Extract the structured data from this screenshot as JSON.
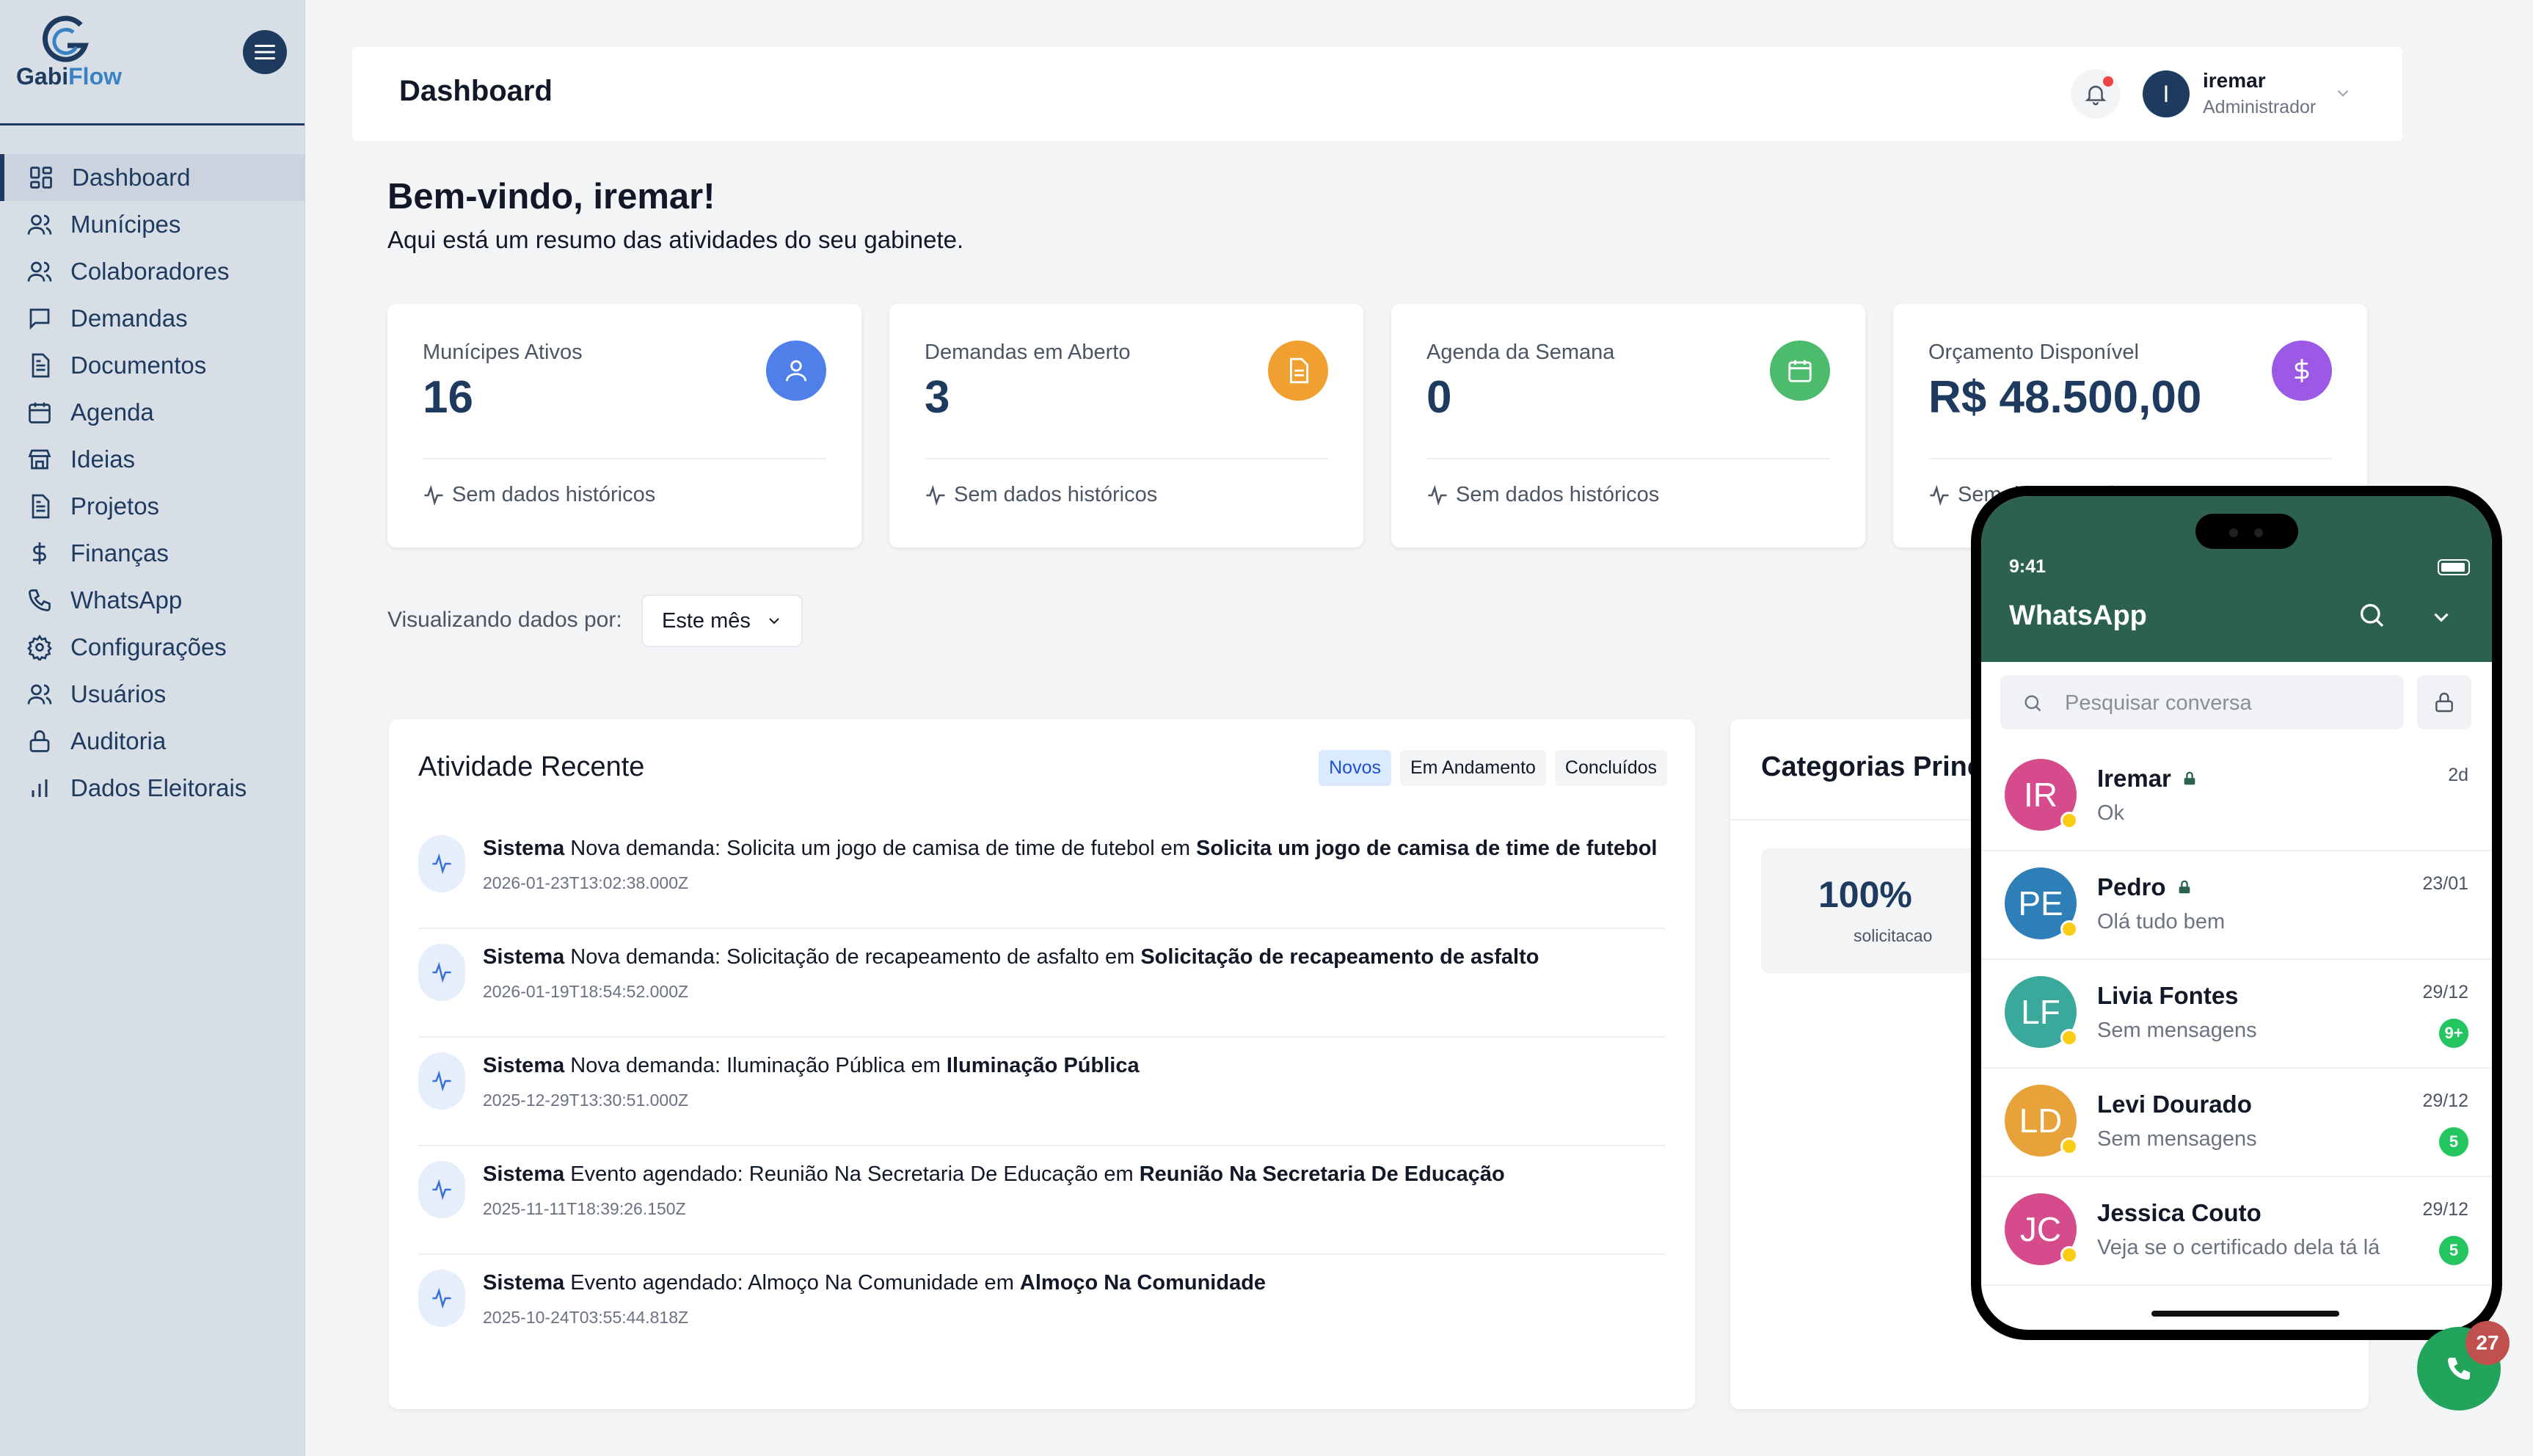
{
  "brand": {
    "name_part1": "Gabi",
    "name_part2": "Flow"
  },
  "sidebar": {
    "items": [
      {
        "label": "Dashboard",
        "icon": "grid-icon",
        "active": true
      },
      {
        "label": "Munícipes",
        "icon": "users-icon"
      },
      {
        "label": "Colaboradores",
        "icon": "users-icon"
      },
      {
        "label": "Demandas",
        "icon": "chat-square-icon"
      },
      {
        "label": "Documentos",
        "icon": "document-icon"
      },
      {
        "label": "Agenda",
        "icon": "calendar-icon"
      },
      {
        "label": "Ideias",
        "icon": "store-icon"
      },
      {
        "label": "Projetos",
        "icon": "document-icon"
      },
      {
        "label": "Finanças",
        "icon": "dollar-icon"
      },
      {
        "label": "WhatsApp",
        "icon": "phone-icon"
      },
      {
        "label": "Configurações",
        "icon": "gear-icon"
      },
      {
        "label": "Usuários",
        "icon": "users-icon"
      },
      {
        "label": "Auditoria",
        "icon": "lock-icon"
      },
      {
        "label": "Dados Eleitorais",
        "icon": "bar-chart-icon"
      }
    ]
  },
  "header": {
    "title": "Dashboard",
    "user": {
      "initial": "I",
      "name": "iremar",
      "role": "Administrador"
    }
  },
  "welcome": {
    "title": "Bem-vindo, iremar!",
    "subtitle": "Aqui está um resumo das atividades do seu gabinete."
  },
  "stats": [
    {
      "label": "Munícipes Ativos",
      "value": "16",
      "trend": "Sem dados históricos",
      "icon": "user-icon",
      "color": "#4f7fe8"
    },
    {
      "label": "Demandas em Aberto",
      "value": "3",
      "trend": "Sem dados históricos",
      "icon": "document-icon",
      "color": "#f0a030"
    },
    {
      "label": "Agenda da Semana",
      "value": "0",
      "trend": "Sem dados históricos",
      "icon": "calendar-icon",
      "color": "#4cbc6c"
    },
    {
      "label": "Orçamento Disponível",
      "value": "R$ 48.500,00",
      "trend": "Sem dados históricos",
      "icon": "dollar-icon",
      "color": "#9b59e6"
    }
  ],
  "filter": {
    "label": "Visualizando dados por:",
    "selected": "Este mês"
  },
  "activity": {
    "title": "Atividade Recente",
    "tabs": [
      "Novos",
      "Em Andamento",
      "Concluídos"
    ],
    "items": [
      {
        "actor": "Sistema",
        "text": " Nova demanda: Solicita um jogo de camisa de time de futebol em ",
        "target": "Solicita um jogo de camisa de time de futebol",
        "time": "2026-01-23T13:02:38.000Z"
      },
      {
        "actor": "Sistema",
        "text": " Nova demanda: Solicitação de recapeamento de asfalto em ",
        "target": "Solicitação de recapeamento de asfalto",
        "time": "2026-01-19T18:54:52.000Z"
      },
      {
        "actor": "Sistema",
        "text": " Nova demanda: Iluminação Pública em ",
        "target": "Iluminação Pública",
        "time": "2025-12-29T13:30:51.000Z"
      },
      {
        "actor": "Sistema",
        "text": " Evento agendado: Reunião Na Secretaria De Educação em ",
        "target": "Reunião Na Secretaria De Educação",
        "time": "2025-11-11T18:39:26.150Z"
      },
      {
        "actor": "Sistema",
        "text": " Evento agendado: Almoço Na Comunidade em ",
        "target": "Almoço Na Comunidade",
        "time": "2025-10-24T03:55:44.818Z"
      }
    ]
  },
  "categories": {
    "title": "Categorias Princ",
    "top": {
      "percent": "100%",
      "name": "solicitacao"
    }
  },
  "whatsapp": {
    "time": "9:41",
    "title": "WhatsApp",
    "search_placeholder": "Pesquisar conversa",
    "chats": [
      {
        "initials": "IR",
        "name": "Iremar",
        "locked": true,
        "message": "Ok",
        "date": "2d",
        "badge": "",
        "color": "#d64b8c"
      },
      {
        "initials": "PE",
        "name": "Pedro",
        "locked": true,
        "message": "Olá tudo bem",
        "date": "23/01",
        "badge": "",
        "color": "#2e7fb8"
      },
      {
        "initials": "LF",
        "name": "Livia Fontes",
        "locked": false,
        "message": "Sem mensagens",
        "date": "29/12",
        "badge": "9+",
        "color": "#3aa89a"
      },
      {
        "initials": "LD",
        "name": "Levi Dourado",
        "locked": false,
        "message": "Sem mensagens",
        "date": "29/12",
        "badge": "5",
        "color": "#e8a23a"
      },
      {
        "initials": "JC",
        "name": "Jessica Couto",
        "locked": false,
        "message": "Veja se o certificado dela tá lá",
        "date": "29/12",
        "badge": "5",
        "color": "#d64b8c"
      }
    ]
  },
  "fab": {
    "badge": "27"
  }
}
